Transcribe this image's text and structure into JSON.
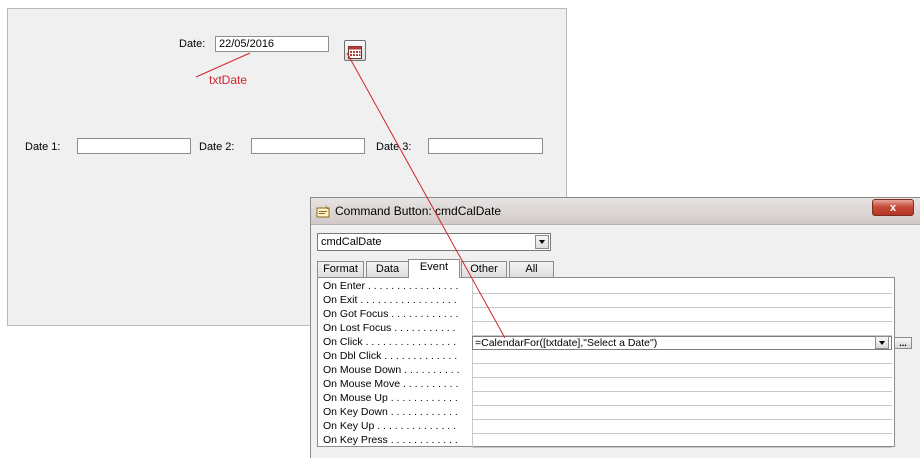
{
  "form": {
    "date_label": "Date:",
    "date_value": "22/05/2016",
    "control_name_label": "txtDate",
    "date1_label": "Date 1:",
    "date2_label": "Date 2:",
    "date3_label": "Date 3:",
    "date1_value": "",
    "date2_value": "",
    "date3_value": "",
    "calendar_icon": "calendar-icon"
  },
  "property_sheet": {
    "title": "Command Button: cmdCalDate",
    "close_label": "x",
    "object_selector": "cmdCalDate",
    "tabs": [
      {
        "label": "Format",
        "active": false
      },
      {
        "label": "Data",
        "active": false
      },
      {
        "label": "Event",
        "active": true
      },
      {
        "label": "Other",
        "active": false
      },
      {
        "label": "All",
        "active": false
      }
    ],
    "active_tab": "Event",
    "rows": [
      {
        "name": "On Enter . . . . . . . . . . . . . . . .",
        "value": ""
      },
      {
        "name": "On Exit . . . . . . . . . . . . . . . . .",
        "value": ""
      },
      {
        "name": "On Got Focus . . . . . . . . . . . .",
        "value": ""
      },
      {
        "name": "On Lost Focus . . . . . . . . . . .",
        "value": ""
      },
      {
        "name": "On Click . . . . . . . . . . . . . . . .",
        "value": "=CalendarFor([txtdate],\"Select a Date\")"
      },
      {
        "name": "On Dbl Click . . . . . . . . . . . . .",
        "value": ""
      },
      {
        "name": "On Mouse Down . . . . . . . . . .",
        "value": ""
      },
      {
        "name": "On Mouse Move . . . . . . . . . .",
        "value": ""
      },
      {
        "name": "On Mouse Up . . . . . . . . . . . .",
        "value": ""
      },
      {
        "name": "On Key Down . . . . . . . . . . . .",
        "value": ""
      },
      {
        "name": "On Key Up . . . . . . . . . . . . . .",
        "value": ""
      },
      {
        "name": "On Key Press . . . . . . . . . . . .",
        "value": ""
      }
    ],
    "builder_label": "...",
    "accent_colors": {
      "annotation_red": "#d0242b",
      "close_red": "#c74c3a"
    }
  }
}
